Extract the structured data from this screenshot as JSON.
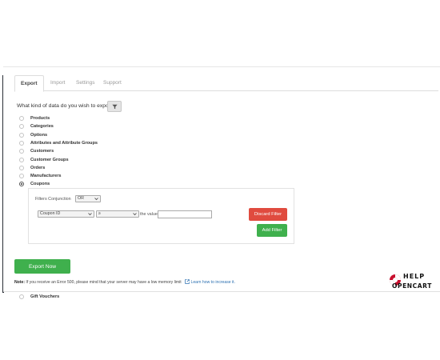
{
  "tabs": [
    {
      "label": "Export",
      "active": true
    },
    {
      "label": "Import",
      "active": false
    },
    {
      "label": "Settings",
      "active": false
    },
    {
      "label": "Support",
      "active": false
    }
  ],
  "question": "What kind of data do you wish to export?",
  "export_types": [
    {
      "label": "Products",
      "checked": false
    },
    {
      "label": "Categories",
      "checked": false
    },
    {
      "label": "Options",
      "checked": false
    },
    {
      "label": "Attributes and Attribute Groups",
      "checked": false
    },
    {
      "label": "Customers",
      "checked": false
    },
    {
      "label": "Customer Groups",
      "checked": false
    },
    {
      "label": "Orders",
      "checked": false
    },
    {
      "label": "Manufacturers",
      "checked": false
    },
    {
      "label": "Coupons",
      "checked": true
    },
    {
      "label": "Gift Vouchers",
      "checked": false
    }
  ],
  "filters": {
    "conjunction_label": "Filters Conjunction",
    "conjunction_value": "OR",
    "field_value": "Coupon ID",
    "operator_value": "≥",
    "the_value_label": "the value",
    "value_input": "",
    "discard_label": "Discard Filter",
    "add_label": "Add Filter"
  },
  "export_button": "Export Now",
  "note": {
    "prefix": "Note:",
    "text": " If you receive an Error 500, please mind that your server may have a low memory limit",
    "link": "Learn how to increase it."
  },
  "logo": {
    "line1": "HELP",
    "line2": "OPENCART"
  },
  "colors": {
    "green": "#3fb04d",
    "red": "#e04b3f",
    "link": "#2a6fb0"
  }
}
